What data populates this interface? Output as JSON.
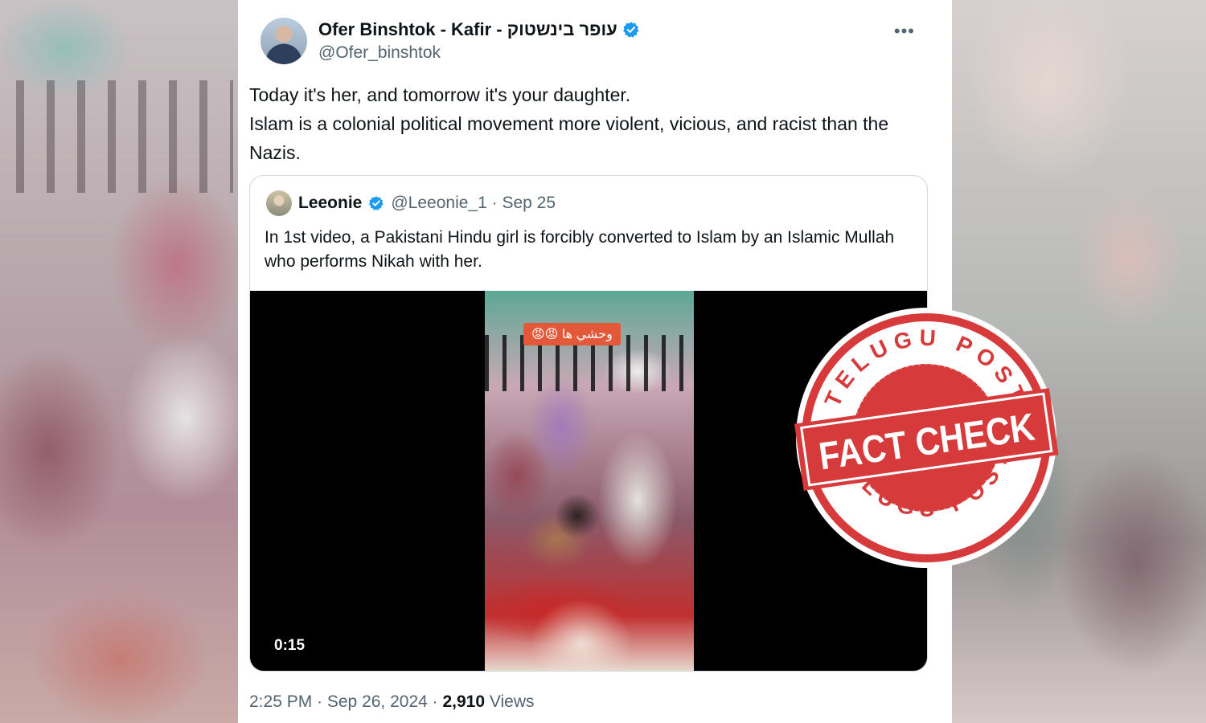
{
  "tweet": {
    "author_name": "Ofer Binshtok - Kafir - עופר בינשטוק",
    "author_handle": "@Ofer_binshtok",
    "more_label": "•••",
    "text_lines": [
      "Today it's her, and tomorrow it's your daughter.",
      "Islam is a colonial political movement more violent, vicious, and racist than the Nazis."
    ],
    "footer": {
      "time": "2:25 PM · Sep 26, 2024 · ",
      "views_count": "2,910",
      "views_label": " Views"
    }
  },
  "quote": {
    "name": "Leeonie",
    "handle_date": "@Leeonie_1 · Sep 25",
    "text": "In 1st video, a Pakistani Hindu girl is forcibly converted to Islam by an Islamic Mullah who performs Nikah with her.",
    "video": {
      "sticker": "وحشي ها 😡😡",
      "duration": "0:15"
    }
  },
  "stamp": {
    "top_text": "TELUGU POST",
    "banner": "FACT CHECK",
    "bottom_text": "TELUGU POST",
    "color": "#d63a3a"
  },
  "colors": {
    "verified": "#1d9bf0",
    "muted_text": "#536471",
    "primary_text": "#0f1419"
  }
}
